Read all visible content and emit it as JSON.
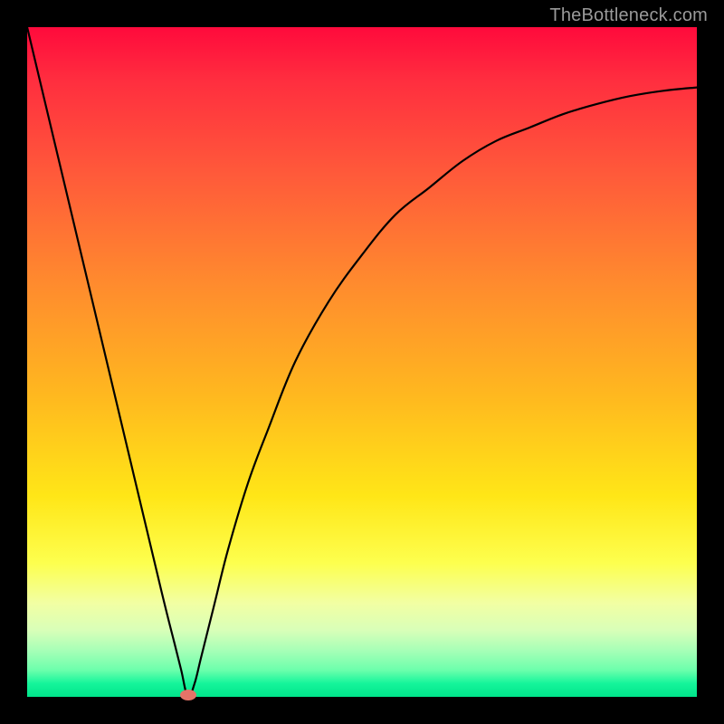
{
  "watermark": "TheBottleneck.com",
  "chart_data": {
    "type": "line",
    "title": "",
    "xlabel": "",
    "ylabel": "",
    "xlim": [
      0,
      100
    ],
    "ylim": [
      0,
      100
    ],
    "grid": false,
    "legend": false,
    "annotations": [],
    "marker": {
      "x": 24,
      "y": 0
    },
    "series": [
      {
        "name": "curve",
        "x": [
          0,
          5,
          10,
          15,
          20,
          22,
          23,
          24,
          25,
          26,
          28,
          30,
          33,
          36,
          40,
          45,
          50,
          55,
          60,
          65,
          70,
          75,
          80,
          85,
          90,
          95,
          100
        ],
        "y": [
          100,
          79,
          58,
          37,
          16,
          8,
          4,
          0,
          2,
          6,
          14,
          22,
          32,
          40,
          50,
          59,
          66,
          72,
          76,
          80,
          83,
          85,
          87,
          88.5,
          89.7,
          90.5,
          91
        ]
      }
    ]
  }
}
